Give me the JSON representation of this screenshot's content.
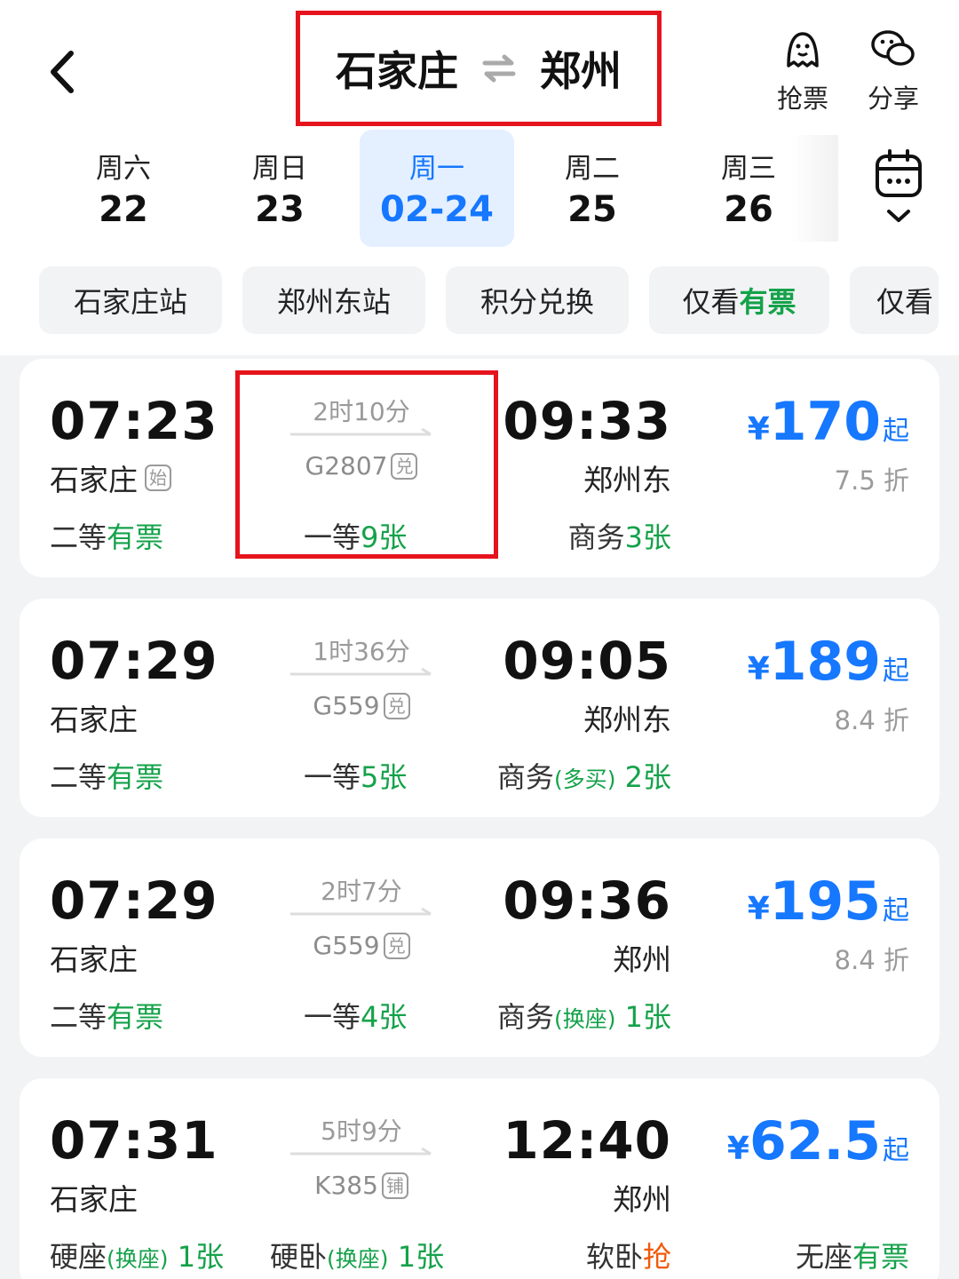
{
  "header": {
    "from": "石家庄",
    "to": "郑州",
    "grab_label": "抢票",
    "share_label": "分享"
  },
  "dates": [
    {
      "weekday": "周六",
      "day": "22",
      "active": false
    },
    {
      "weekday": "周日",
      "day": "23",
      "active": false
    },
    {
      "weekday": "周一",
      "day": "02-24",
      "active": true
    },
    {
      "weekday": "周二",
      "day": "25",
      "active": false
    },
    {
      "weekday": "周三",
      "day": "26",
      "active": false
    }
  ],
  "filters": {
    "f1": "石家庄站",
    "f2": "郑州东站",
    "f3": "积分兑换",
    "f4_pre": "仅看",
    "f4_hl": "有票",
    "f5": "仅看"
  },
  "trains": [
    {
      "dep_time": "07:23",
      "dep_station": "石家庄",
      "dep_tag": "始",
      "duration": "2时10分",
      "number": "G2807",
      "number_tag": "兑",
      "arr_time": "09:33",
      "arr_station": "郑州东",
      "price_symbol": "¥",
      "price": "170",
      "price_suffix": "起",
      "discount": "7.5 折",
      "s1_class": "二等",
      "s1_status": "有票",
      "s2_class": "一等",
      "s2_count": "9",
      "s2_unit": "张",
      "s3_class": "商务",
      "s3_note": "",
      "s3_count": "3",
      "s3_unit": "张"
    },
    {
      "dep_time": "07:29",
      "dep_station": "石家庄",
      "dep_tag": "",
      "duration": "1时36分",
      "number": "G559",
      "number_tag": "兑",
      "arr_time": "09:05",
      "arr_station": "郑州东",
      "price_symbol": "¥",
      "price": "189",
      "price_suffix": "起",
      "discount": "8.4 折",
      "s1_class": "二等",
      "s1_status": "有票",
      "s2_class": "一等",
      "s2_count": "5",
      "s2_unit": "张",
      "s3_class": "商务",
      "s3_note": "(多买)",
      "s3_count": "2",
      "s3_unit": "张"
    },
    {
      "dep_time": "07:29",
      "dep_station": "石家庄",
      "dep_tag": "",
      "duration": "2时7分",
      "number": "G559",
      "number_tag": "兑",
      "arr_time": "09:36",
      "arr_station": "郑州",
      "price_symbol": "¥",
      "price": "195",
      "price_suffix": "起",
      "discount": "8.4 折",
      "s1_class": "二等",
      "s1_status": "有票",
      "s2_class": "一等",
      "s2_count": "4",
      "s2_unit": "张",
      "s3_class": "商务",
      "s3_note": "(换座)",
      "s3_count": "1",
      "s3_unit": "张"
    },
    {
      "dep_time": "07:31",
      "dep_station": "石家庄",
      "dep_tag": "",
      "duration": "5时9分",
      "number": "K385",
      "number_tag": "铺",
      "arr_time": "12:40",
      "arr_station": "郑州",
      "price_symbol": "¥",
      "price": "62.5",
      "price_suffix": "起",
      "discount": "",
      "s1_class": "硬座",
      "s1_note": "(换座)",
      "s1_count": "1",
      "s1_unit": "张",
      "s2_class": "硬卧",
      "s2_note": "(换座)",
      "s2_count": "1",
      "s2_unit": "张",
      "s3_class": "软卧",
      "s3_status": "抢",
      "s4_class": "无座",
      "s4_status": "有票"
    }
  ],
  "colors": {
    "accent": "#1677ff",
    "available": "#15a24a",
    "grab": "#f05a0a",
    "highlight_box": "#e5141c"
  }
}
